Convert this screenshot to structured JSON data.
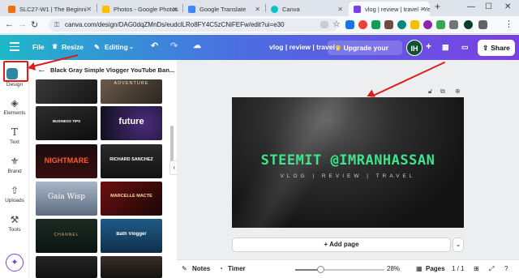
{
  "browser": {
    "tabs": [
      {
        "title": "SLC27-W1 | The Beginni",
        "active": false,
        "favicon_color": "#e8711a"
      },
      {
        "title": "Photos - Google Photos",
        "active": false,
        "favicon_color": "#fbbc04"
      },
      {
        "title": "Google Translate",
        "active": false,
        "favicon_color": "#4285f4"
      },
      {
        "title": "Canva",
        "active": false,
        "favicon_color": "#00c4cc"
      },
      {
        "title": "vlog | review | travel - Ye",
        "active": true,
        "favicon_color": "#7b3fe4"
      }
    ],
    "new_tab_icon": "plus-icon",
    "window_controls": [
      "minimize-icon",
      "maximize-icon",
      "close-icon"
    ],
    "url": "canva.com/design/DAG0dqZMnDs/eudclLRo8FY4C5zCNiFEFw/edit?ui=e30"
  },
  "canva_toolbar": {
    "file_label": "File",
    "resize_label": "Resize",
    "editing_label": "Editing",
    "doc_title": "vlog | review | travel",
    "upgrade_label": "Upgrade your plan",
    "avatar_initials": "IH",
    "share_label": "Share",
    "accent_gradient": [
      "#1fb7c9",
      "#4a6fe0",
      "#7b3fe4"
    ]
  },
  "rail": {
    "items": [
      {
        "label": "Design",
        "icon": "design-icon"
      },
      {
        "label": "Elements",
        "icon": "shapes-icon"
      },
      {
        "label": "Text",
        "icon": "text-icon"
      },
      {
        "label": "Brand",
        "icon": "brand-icon"
      },
      {
        "label": "Uploads",
        "icon": "cloud-upload-icon"
      },
      {
        "label": "Tools",
        "icon": "tools-icon"
      }
    ],
    "highlight_color": "#e01b1b"
  },
  "panel": {
    "title": "Black Gray Simple Vlogger YouTube Ban...",
    "thumbnails": [
      {
        "text": "ADVENTURE"
      },
      {
        "text": "BUSINESS TIPS"
      },
      {
        "text": "future"
      },
      {
        "text": "NIGHTMARE"
      },
      {
        "text": "RICHARD SANCHEZ"
      },
      {
        "text": "Gaia Wisp"
      },
      {
        "text": "MARCELLE MACTE"
      },
      {
        "text": "CHANNEL"
      },
      {
        "text": "Bath Vlogger"
      }
    ]
  },
  "canvas": {
    "title": "STEEMIT @IMRANHASSAN",
    "subtitle": "VLOG | REVIEW | TRAVEL",
    "title_color": "#3fe48c",
    "add_page_label": "+ Add page"
  },
  "bottom_bar": {
    "notes_label": "Notes",
    "timer_label": "Timer",
    "zoom_label": "28%",
    "zoom_fraction": 0.28,
    "pages_label": "Pages",
    "page_count": "1 / 1"
  }
}
